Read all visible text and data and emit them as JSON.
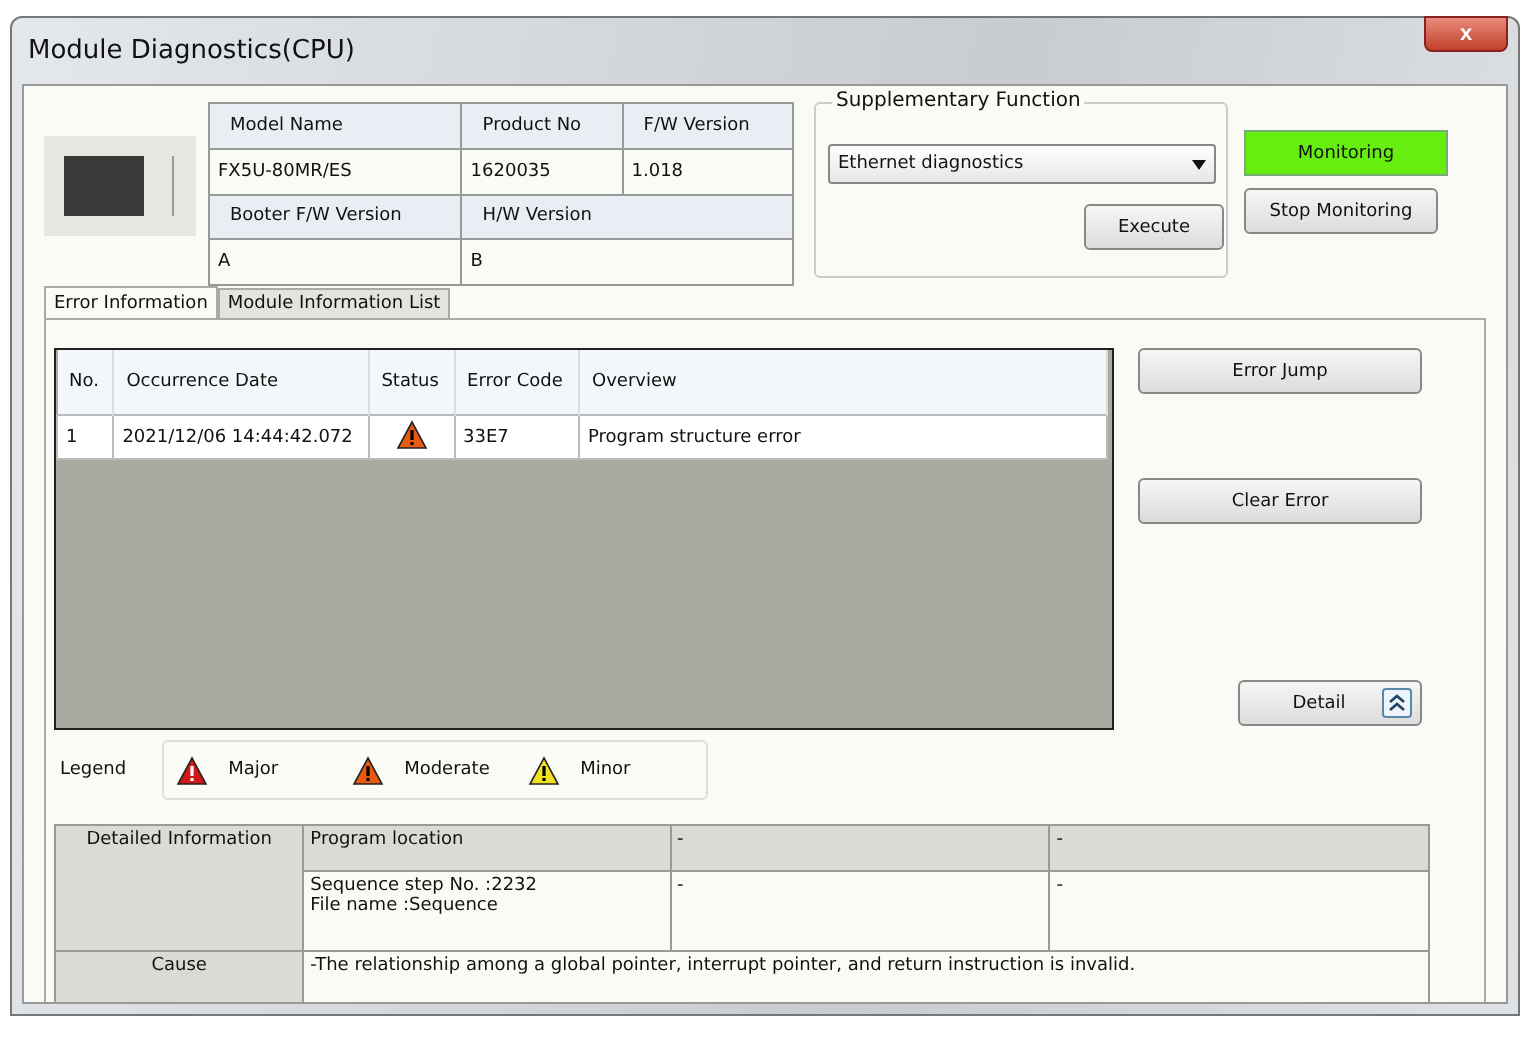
{
  "window": {
    "title": "Module Diagnostics(CPU)",
    "close": "x"
  },
  "module_info": {
    "headers1": [
      "Model Name",
      "Product No",
      "F/W Version"
    ],
    "values1": [
      "FX5U-80MR/ES",
      "1620035",
      "1.018"
    ],
    "headers2": [
      "Booter F/W Version",
      "H/W Version"
    ],
    "values2": [
      "A",
      "B"
    ]
  },
  "supplementary": {
    "title": "Supplementary Function",
    "dropdown": "Ethernet diagnostics",
    "execute": "Execute"
  },
  "monitoring": {
    "status": "Monitoring",
    "on": true,
    "stop": "Stop Monitoring"
  },
  "tabs": [
    {
      "label": "Error Information",
      "selected": true
    },
    {
      "label": "Module Information List",
      "selected": false
    }
  ],
  "error_table": {
    "columns": [
      "No.",
      "Occurrence Date",
      "Status",
      "Error Code",
      "Overview"
    ],
    "rows": [
      {
        "no": "1",
        "date": "2021/12/06 14:44:42.072",
        "kind": "moderate",
        "code": "33E7",
        "overview": "Program structure error"
      }
    ]
  },
  "side_buttons": {
    "error_jump": "Error Jump",
    "clear_error": "Clear Error",
    "detail": "Detail"
  },
  "legend": {
    "label": "Legend",
    "items": [
      {
        "kind": "major",
        "label": "Major"
      },
      {
        "kind": "moderate",
        "label": "Moderate"
      },
      {
        "kind": "minor",
        "label": "Minor"
      }
    ]
  },
  "details": {
    "rows": [
      {
        "label": "Detailed Information",
        "cells": [
          "Program location",
          "-",
          "-"
        ],
        "kind": "header"
      },
      {
        "cells": [
          "Sequence step No. :2232\nFile name :Sequence",
          "-",
          "-"
        ],
        "kind": "body"
      },
      {
        "label": "Cause",
        "cells": [
          {
            "text": "-The relationship among a global pointer, interrupt pointer, and return instruction is invalid.",
            "colspan": 3
          }
        ],
        "kind": "wide"
      }
    ]
  }
}
